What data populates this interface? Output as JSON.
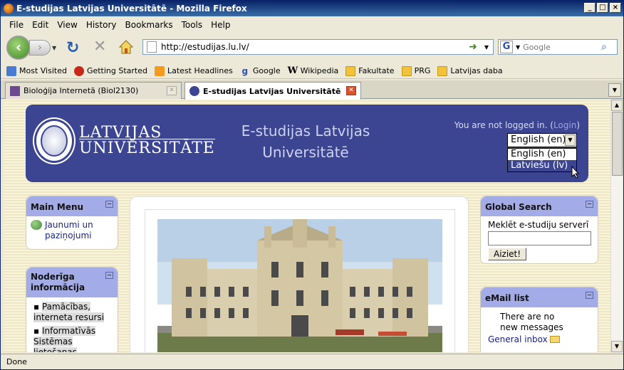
{
  "window": {
    "title": "E-studijas Latvijas Universitātē - Mozilla Firefox",
    "buttons": [
      "_",
      "□",
      "×"
    ]
  },
  "menu": [
    "File",
    "Edit",
    "View",
    "History",
    "Bookmarks",
    "Tools",
    "Help"
  ],
  "nav": {
    "url": "http://estudijas.lu.lv/",
    "search_placeholder": "Google",
    "search_engine": "G"
  },
  "bookmarks": [
    {
      "label": "Most Visited",
      "icon": "most-visited-icon"
    },
    {
      "label": "Getting Started",
      "icon": "firefox-icon"
    },
    {
      "label": "Latest Headlines",
      "icon": "rss-icon"
    },
    {
      "label": "Google",
      "icon": "google-icon"
    },
    {
      "label": "Wikipedia",
      "icon": "wikipedia-icon"
    },
    {
      "label": "Fakultate",
      "icon": "folder-icon"
    },
    {
      "label": "PRG",
      "icon": "folder-icon"
    },
    {
      "label": "Latvijas daba",
      "icon": "folder-icon"
    }
  ],
  "tabs": [
    {
      "label": "Bioloģija Internetā (Biol2130)",
      "active": false
    },
    {
      "label": "E-studijas Latvijas Universitātē",
      "active": true
    }
  ],
  "status": "Done",
  "page": {
    "logo_line1": "LATVIJAS",
    "logo_line2": "UNIVERSITĀTE",
    "site_title_line1": "E-studijas Latvijas",
    "site_title_line2": "Universitātē",
    "login_text": "You are not logged in. (",
    "login_link": "Login",
    "login_close": ")",
    "language_selected": "English (en)",
    "language_options": [
      "English (en)",
      "Latviešu (lv)"
    ],
    "main_menu": {
      "title": "Main Menu",
      "items": [
        "Jaunumi un paziņojumi"
      ]
    },
    "useful_info": {
      "title": "Noderīga informācija",
      "items": [
        "Pamācības, interneta resursi",
        "Informatīvās Sistēmas lietošanas"
      ]
    },
    "global_search": {
      "title": "Global Search",
      "label": "Meklēt e-studiju serverī",
      "button": "Aiziet!"
    },
    "email_list": {
      "title": "eMail list",
      "message": "There are no new messages",
      "inbox_link": "General inbox"
    }
  },
  "colors": {
    "header": "#3b4591",
    "block_head": "#a3ace6",
    "background": "#efe7c4"
  }
}
